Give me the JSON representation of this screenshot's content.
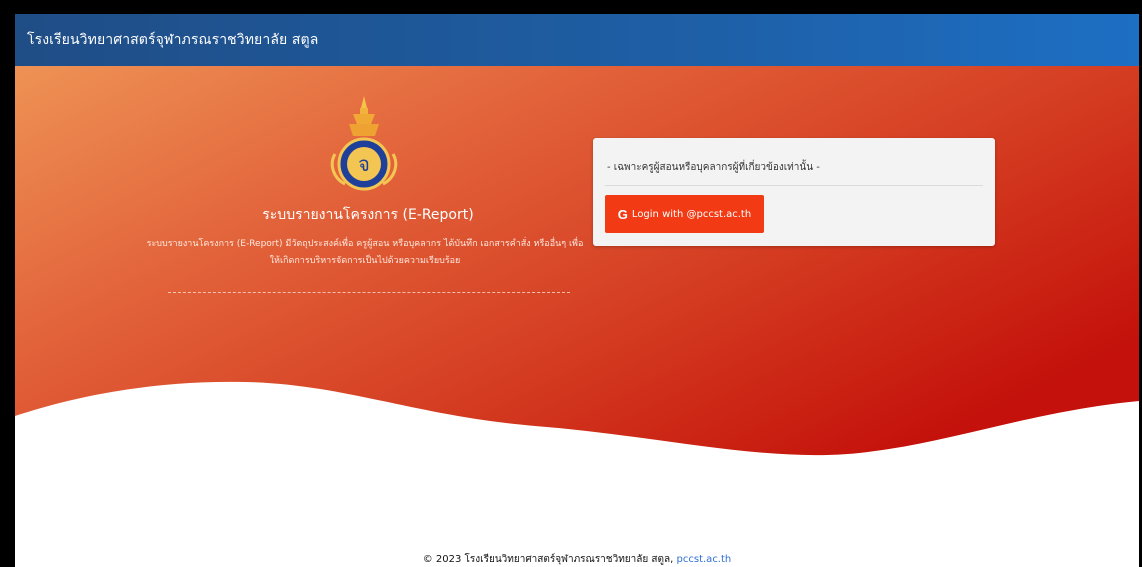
{
  "header": {
    "title": "โรงเรียนวิทยาศาสตร์จุฬาภรณราชวิทยาลัย สตูล"
  },
  "hero": {
    "app_title": "ระบบรายงานโครงการ (E-Report)",
    "description": "ระบบรายงานโครงการ (E-Report) มีวัตถุประสงค์เพื่อ ครูผู้สอน หรือบุคลากร ได้บันทึก เอกสารคำสั่ง หรืออื่นๆ    เพื่อให้เกิดการบริหารจัดการเป็นไปด้วยความเรียบร้อย",
    "logo_icon": "school-emblem-icon"
  },
  "login_card": {
    "note": "- เฉพาะครูผู้สอนหรือบุคลากรผู้ที่เกี่ยวข้องเท่านั้น -",
    "button_icon": "G",
    "button_label": "Login with @pccst.ac.th"
  },
  "footer": {
    "copyright": "© 2023 โรงเรียนวิทยาศาสตร์จุฬาภรณราชวิทยาลัย สตูล, ",
    "link_text": "pccst.ac.th"
  },
  "colors": {
    "navbar": "#1e5fa6",
    "hero_start": "#ee9255",
    "hero_end": "#c4110b",
    "button": "#f23b14",
    "link": "#2f6fd6"
  }
}
